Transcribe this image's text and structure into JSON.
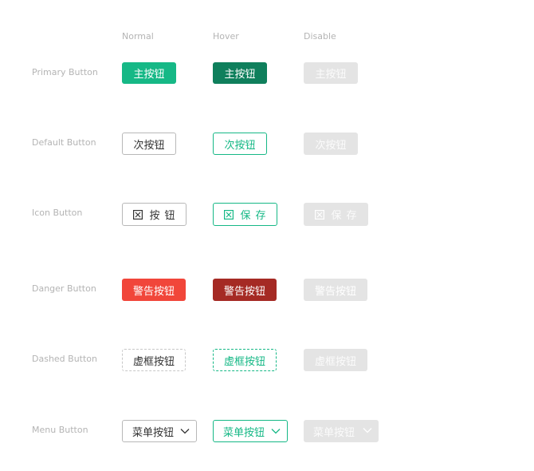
{
  "colors": {
    "green": "#16b886",
    "green_dark": "#0f7f5c",
    "red": "#f1463a",
    "red_dark": "#a52a24",
    "disabled_bg": "#e4e4e4"
  },
  "columns": {
    "normal": "Normal",
    "hover": "Hover",
    "disable": "Disable"
  },
  "rows": {
    "primary": {
      "label": "Primary Button",
      "text": "主按钮"
    },
    "default": {
      "label": "Default Button",
      "text": "次按钮"
    },
    "icon": {
      "label": "Icon Button",
      "icon": "close-box-icon",
      "normal_text": "按钮",
      "hover_text": "保存",
      "disable_text": "保存"
    },
    "danger": {
      "label": "Danger Button",
      "text": "警告按钮"
    },
    "dashed": {
      "label": "Dashed Button",
      "text": "虚框按钮"
    },
    "menu": {
      "label": "Menu Button",
      "text": "菜单按钮",
      "icon": "chevron-down-icon"
    }
  }
}
